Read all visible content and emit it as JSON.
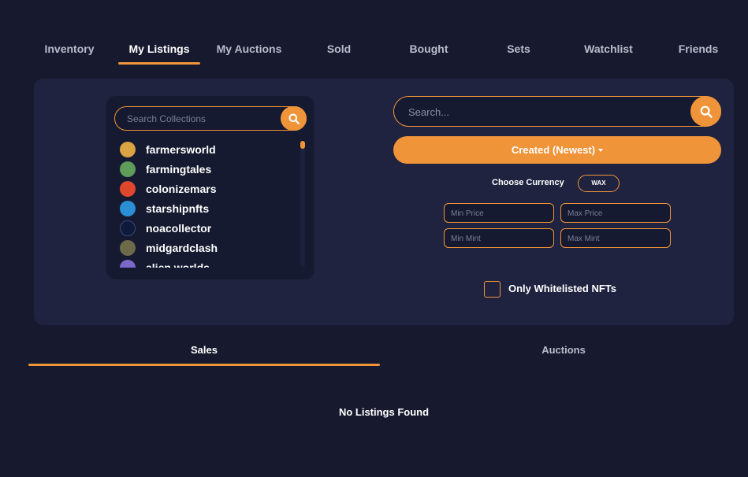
{
  "nav": {
    "tabs": [
      {
        "label": "Inventory"
      },
      {
        "label": "My Listings",
        "active": true
      },
      {
        "label": "My Auctions"
      },
      {
        "label": "Sold"
      },
      {
        "label": "Bought"
      },
      {
        "label": "Sets"
      },
      {
        "label": "Watchlist"
      },
      {
        "label": "Friends"
      }
    ]
  },
  "collections": {
    "search_placeholder": "Search Collections",
    "search_icon": "search-icon",
    "items": [
      {
        "name": "farmersworld",
        "color": "#d9a441"
      },
      {
        "name": "farmingtales",
        "color": "#5e9c5a"
      },
      {
        "name": "colonizemars",
        "color": "#e0482e"
      },
      {
        "name": "starshipnfts",
        "color": "#2b8fd6"
      },
      {
        "name": "noacollector",
        "color": "#0f1a3a"
      },
      {
        "name": "midgardclash",
        "color": "#6d6a4a"
      },
      {
        "name": "alien.worlds",
        "color": "#7b68c9"
      }
    ]
  },
  "search": {
    "placeholder": "Search...",
    "icon": "search-icon"
  },
  "sort": {
    "label": "Created (Newest)"
  },
  "currency": {
    "label": "Choose Currency",
    "value": "WAX"
  },
  "filters": {
    "min_price": "Min Price",
    "max_price": "Max Price",
    "min_mint": "Min Mint",
    "max_mint": "Max Mint"
  },
  "whitelist": {
    "label": "Only Whitelisted NFTs"
  },
  "subtabs": [
    {
      "label": "Sales",
      "active": true
    },
    {
      "label": "Auctions"
    }
  ],
  "empty_message": "No Listings Found",
  "colors": {
    "accent": "#f0943a",
    "background": "#171a2e",
    "panel": "#1f2340"
  }
}
